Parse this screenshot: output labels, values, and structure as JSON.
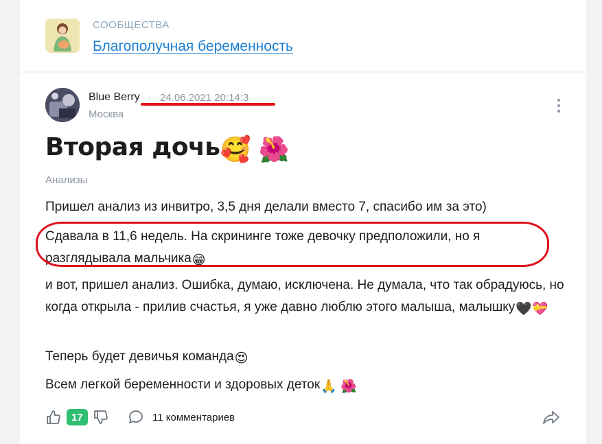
{
  "community": {
    "label": "СООБЩЕСТВА",
    "name": "Благополучная беременность"
  },
  "post": {
    "author": "Blue Berry",
    "separator": "·",
    "date": "24.06.2021 20:14:3",
    "city": "Москва",
    "title": "Вторая дочь",
    "title_emojis": "🥰 🌺",
    "tag": "Анализы",
    "paragraphs": [
      "Пришел анализ из инвитро, 3,5 дня делали вместо 7, спасибо им за это)",
      "Сдавала в 11,6 недель. На скрининге тоже девочку предположили, но я разглядывала мальчика",
      "и вот, пришел анализ. Ошибка, думаю, исключена. Не думала, что так обрадуюсь, но когда открыла - прилив счастья, я уже давно люблю этого малыша, малышку",
      "Теперь будет девичья команда",
      "Всем легкой беременности и здоровых деток"
    ],
    "paragraph_emojis": [
      "",
      "😁",
      "🖤💝",
      "😍",
      "🙏 🌺"
    ]
  },
  "actions": {
    "likes": "17",
    "comments": "11 комментариев"
  },
  "icons": {
    "more": "more-vertical-icon",
    "like": "thumb-up-icon",
    "dislike": "thumb-down-icon",
    "comment": "comment-bubble-icon",
    "share": "share-arrow-icon"
  },
  "colors": {
    "link": "#1b7fd4",
    "like_badge": "#2fbf71",
    "annotation_red": "#e0101c",
    "muted": "#8c95a0"
  }
}
